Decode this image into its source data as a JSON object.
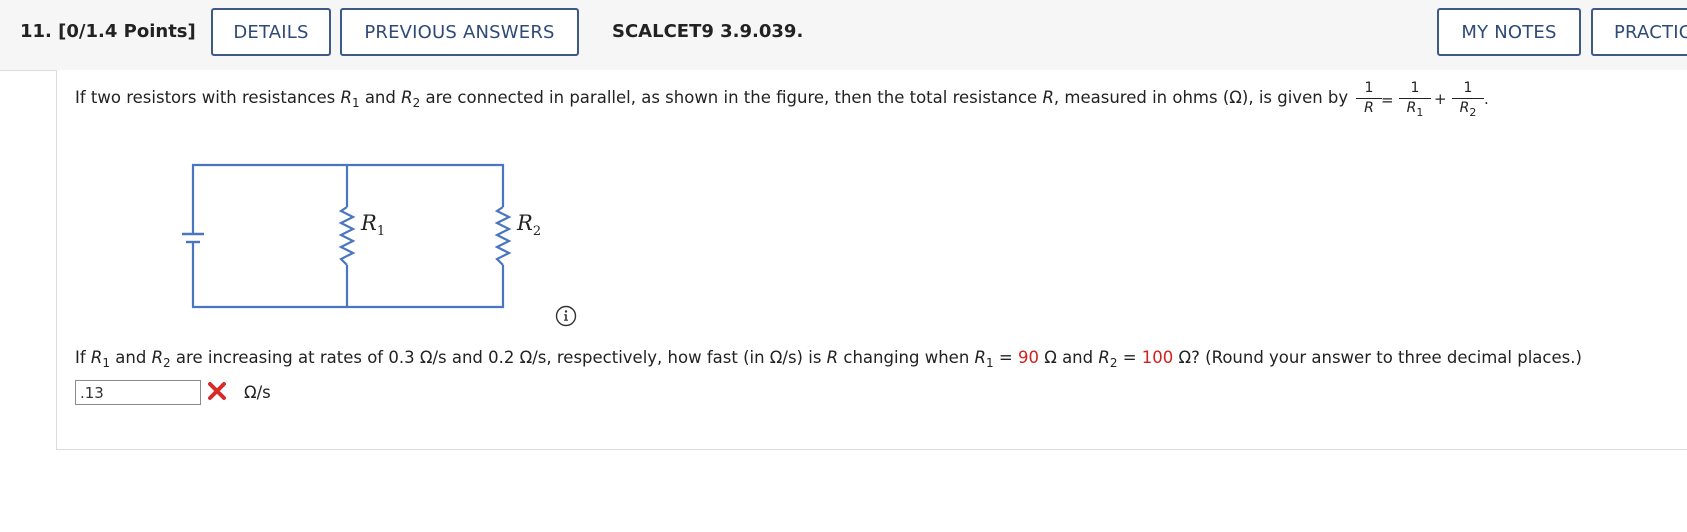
{
  "header": {
    "question_number": "11.",
    "points": "[0/1.4 Points]",
    "details_label": "DETAILS",
    "previous_answers_label": "PREVIOUS ANSWERS",
    "question_code": "SCALCET9 3.9.039.",
    "my_notes_label": "MY NOTES",
    "practice_label": "PRACTIC"
  },
  "question": {
    "intro_part1": "If two resistors with resistances ",
    "r": "R",
    "sub1": "1",
    "sub2": "2",
    "and": " and ",
    "intro_part2": " are connected in parallel, as shown in the figure, then the total resistance ",
    "intro_part3": ", measured in ohms (Ω), is given by",
    "formula": {
      "one": "1",
      "equals": "=",
      "plus": "+",
      "period": "."
    },
    "figure": {
      "r1_label": "R",
      "r1_sub": "1",
      "r2_label": "R",
      "r2_sub": "2"
    },
    "prompt_part1": "If ",
    "prompt_part2": " are increasing at rates of 0.3 Ω/s and 0.2 Ω/s, respectively, how fast (in Ω/s) is ",
    "prompt_part3": " changing when ",
    "eq": " = ",
    "r1_value": "90",
    "ohm_and": " Ω and ",
    "r2_value": "100",
    "prompt_end": " Ω? (Round your answer to three decimal places.)"
  },
  "answer": {
    "value": ".13",
    "units": "Ω/s",
    "status": "incorrect"
  },
  "colors": {
    "button_border": "#3d5a87",
    "highlight_red": "#d0231f",
    "circuit_blue": "#4a76c0"
  }
}
